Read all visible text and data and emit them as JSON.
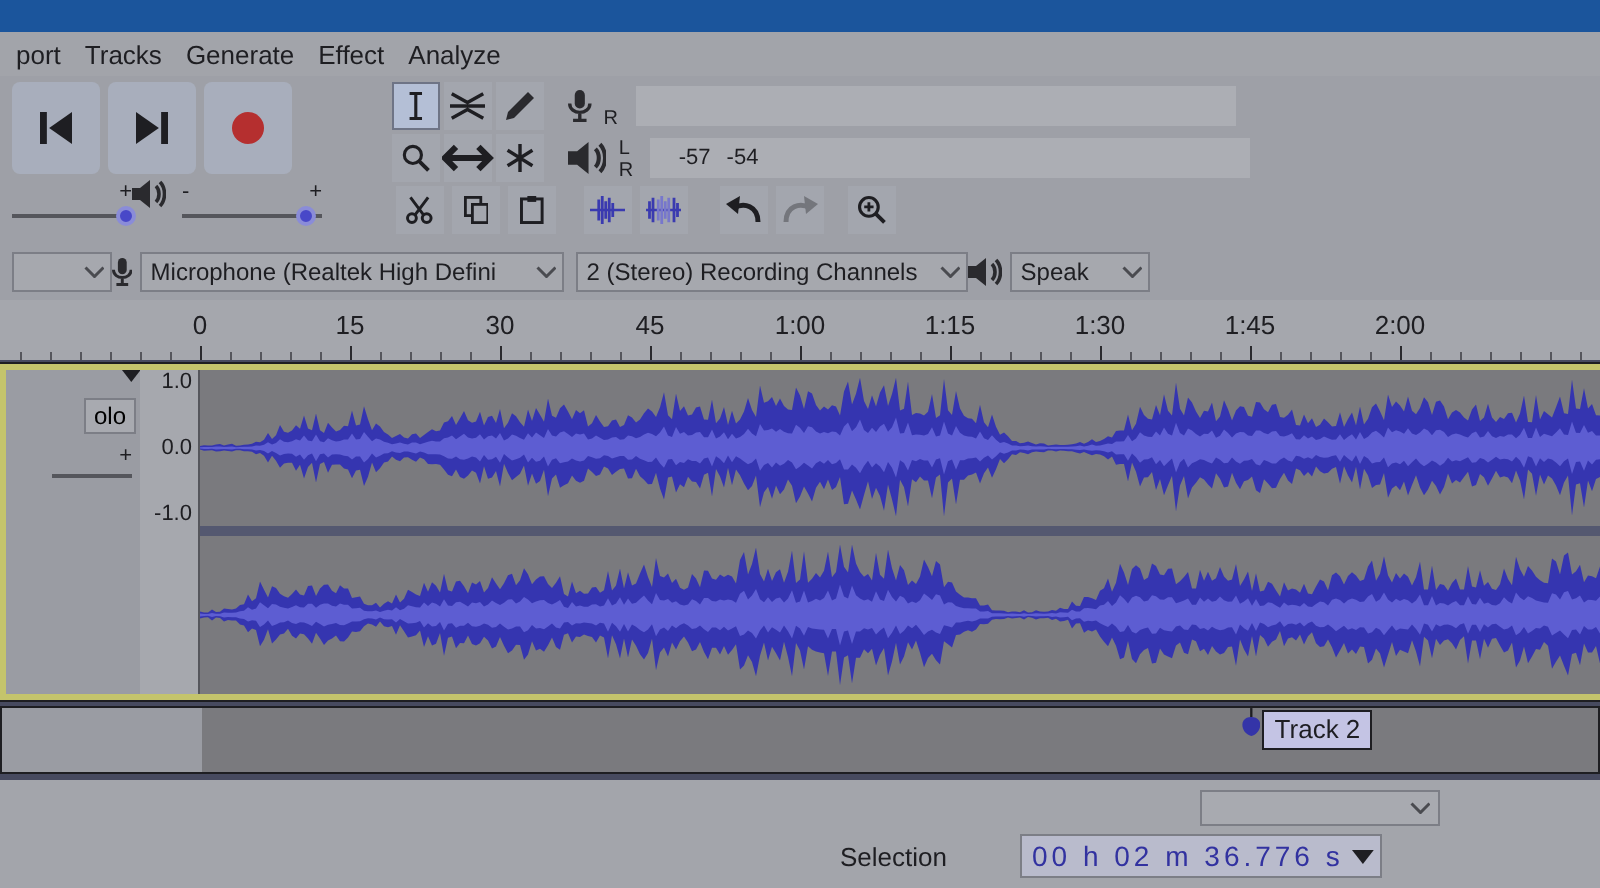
{
  "menu": [
    {
      "label": "port"
    },
    {
      "label": "Tracks"
    },
    {
      "label": "Generate"
    },
    {
      "label": "Effect"
    },
    {
      "label": "Analyze"
    }
  ],
  "transport": [
    {
      "kind": "skip_start"
    },
    {
      "kind": "skip_end"
    },
    {
      "kind": "record"
    }
  ],
  "tools": [
    {
      "kind": "select",
      "selected": true
    },
    {
      "kind": "envelope",
      "selected": false
    },
    {
      "kind": "draw",
      "selected": false
    },
    {
      "kind": "zoom",
      "selected": false
    },
    {
      "kind": "timeshift",
      "selected": false
    },
    {
      "kind": "multi",
      "selected": false
    }
  ],
  "edit": [
    {
      "kind": "cut",
      "disabled": false
    },
    {
      "kind": "copy",
      "disabled": false
    },
    {
      "kind": "paste",
      "disabled": false
    },
    {
      "kind": "trim",
      "disabled": false
    },
    {
      "kind": "silence",
      "disabled": false
    },
    {
      "kind": "undo",
      "disabled": false
    },
    {
      "kind": "redo",
      "disabled": true
    },
    {
      "kind": "zoom_in",
      "disabled": false
    }
  ],
  "meters": [
    {
      "kind": "record",
      "channels": [
        "R"
      ]
    },
    {
      "kind": "playback",
      "channels": [
        "L",
        "R"
      ],
      "scale": [
        "-57",
        "-54"
      ]
    }
  ],
  "mixer": [
    {
      "kind": "recording",
      "plus": "+",
      "level": 0.95
    },
    {
      "kind": "playback",
      "minus": "-",
      "plus": "+",
      "level": 0.88
    }
  ],
  "devices": [
    {
      "kind": "host"
    },
    {
      "kind": "input",
      "value": "Microphone (Realtek High Defini"
    },
    {
      "kind": "channels",
      "value": "2 (Stereo) Recording Channels"
    },
    {
      "kind": "output",
      "value": "Speak"
    }
  ],
  "ruler": {
    "labels": [
      "0",
      "15",
      "30",
      "45",
      "1:00",
      "1:15",
      "1:30",
      "1:45",
      "2:00"
    ]
  },
  "tracks": [
    {
      "kind": "audio",
      "selected": true,
      "solo": "olo",
      "gain_plus": "+",
      "scale": [
        "1.0",
        "0.0",
        "-1.0"
      ]
    },
    {
      "kind": "label",
      "labels": [
        {
          "text": "Track 2"
        }
      ]
    }
  ],
  "selection": {
    "label": "Selection",
    "time": "00 h 02 m 36.776 s"
  }
}
